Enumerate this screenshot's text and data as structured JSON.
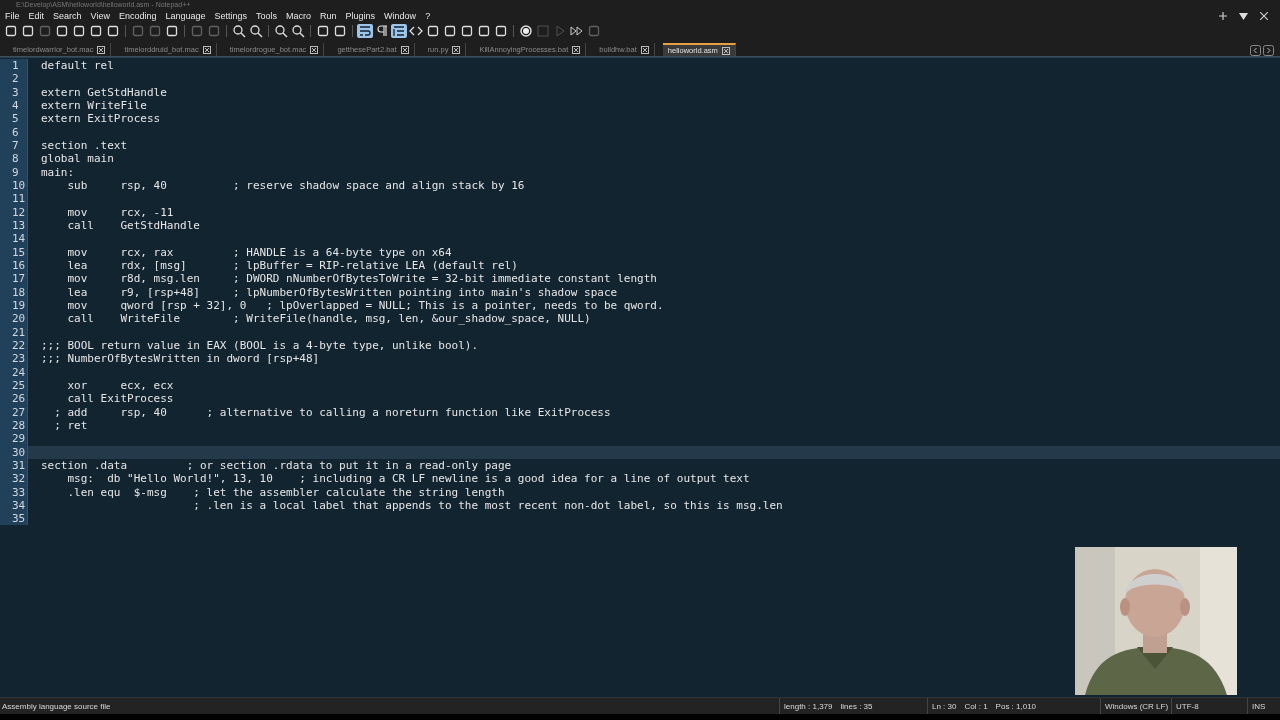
{
  "window": {
    "title": "E:\\Develop\\ASM\\helloworld\\helloworld.asm - Notepad++"
  },
  "menu": [
    "File",
    "Edit",
    "Search",
    "View",
    "Encoding",
    "Language",
    "Settings",
    "Tools",
    "Macro",
    "Run",
    "Plugins",
    "Window",
    "?"
  ],
  "tabs": [
    {
      "label": "timelordwarrior_bot.mac",
      "selected": false
    },
    {
      "label": "timelorddruid_bot.mac",
      "selected": false
    },
    {
      "label": "timelordrogue_bot.mac",
      "selected": false
    },
    {
      "label": "getthesePart2.bat",
      "selected": false
    },
    {
      "label": "run.py",
      "selected": false
    },
    {
      "label": "KillAnnoyingProcesses.bat",
      "selected": false
    },
    {
      "label": "buildhw.bat",
      "selected": false
    },
    {
      "label": "helloworld.asm",
      "selected": true
    }
  ],
  "editor": {
    "lines": [
      {
        "number": "1",
        "text": "default rel",
        "current": false
      },
      {
        "number": "2",
        "current": false
      },
      {
        "number": "3",
        "text": "extern GetStdHandle",
        "current": false
      },
      {
        "number": "4",
        "text": "extern WriteFile",
        "current": false
      },
      {
        "number": "5",
        "text": "extern ExitProcess",
        "current": false
      },
      {
        "number": "6",
        "current": false
      },
      {
        "number": "7",
        "text": "section .text",
        "current": false
      },
      {
        "number": "8",
        "text": "global main",
        "current": false
      },
      {
        "number": "9",
        "text": "main:",
        "current": false
      },
      {
        "number": "10",
        "text": "    sub     rsp, 40          ; reserve shadow space and align stack by 16",
        "current": false
      },
      {
        "number": "11",
        "current": false
      },
      {
        "number": "12",
        "text": "    mov     rcx, -11",
        "current": false
      },
      {
        "number": "13",
        "text": "    call    GetStdHandle",
        "current": false
      },
      {
        "number": "14",
        "current": false
      },
      {
        "number": "15",
        "text": "    mov     rcx, rax         ; HANDLE is a 64-byte type on x64",
        "current": false
      },
      {
        "number": "16",
        "text": "    lea     rdx, [msg]       ; lpBuffer = RIP-relative LEA (default rel)",
        "current": false
      },
      {
        "number": "17",
        "text": "    mov     r8d, msg.len     ; DWORD nNumberOfBytesToWrite = 32-bit immediate constant length",
        "current": false
      },
      {
        "number": "18",
        "text": "    lea     r9, [rsp+48]     ; lpNumberOfBytesWritten pointing into main's shadow space",
        "current": false
      },
      {
        "number": "19",
        "text": "    mov     qword [rsp + 32], 0   ; lpOverlapped = NULL; This is a pointer, needs to be qword.",
        "current": false
      },
      {
        "number": "20",
        "text": "    call    WriteFile        ; WriteFile(handle, msg, len, &our_shadow_space, NULL)",
        "current": false
      },
      {
        "number": "21",
        "current": false
      },
      {
        "number": "22",
        "text": ";;; BOOL return value in EAX (BOOL is a 4-byte type, unlike bool).",
        "current": false
      },
      {
        "number": "23",
        "text": ";;; NumberOfBytesWritten in dword [rsp+48]",
        "current": false
      },
      {
        "number": "24",
        "current": false
      },
      {
        "number": "25",
        "text": "    xor     ecx, ecx",
        "current": false
      },
      {
        "number": "26",
        "text": "    call ExitProcess",
        "current": false
      },
      {
        "number": "27",
        "text": "  ; add     rsp, 40      ; alternative to calling a noreturn function like ExitProcess",
        "current": false
      },
      {
        "number": "28",
        "text": "  ; ret",
        "current": false
      },
      {
        "number": "29",
        "current": false
      },
      {
        "number": "30",
        "current": true
      },
      {
        "number": "31",
        "text": "section .data         ; or section .rdata to put it in a read-only page",
        "current": false
      },
      {
        "number": "32",
        "text": "    msg:  db \"Hello World!\", 13, 10    ; including a CR LF newline is a good idea for a line of output text",
        "current": false
      },
      {
        "number": "33",
        "text": "    .len equ  $-msg    ; let the assembler calculate the string length",
        "current": false
      },
      {
        "number": "34",
        "text": "                       ; .len is a local label that appends to the most recent non-dot label, so this is msg.len",
        "current": false
      },
      {
        "number": "35",
        "current": false
      }
    ]
  },
  "status_bar": {
    "file_type": "Assembly language source file",
    "length": "length : 1,379",
    "lines": "lines : 35",
    "ln": "Ln : 30",
    "col": "Col : 1",
    "pos": "Pos : 1,010",
    "eol": "Windows (CR LF)",
    "encoding": "UTF-8",
    "mode": "INS"
  }
}
